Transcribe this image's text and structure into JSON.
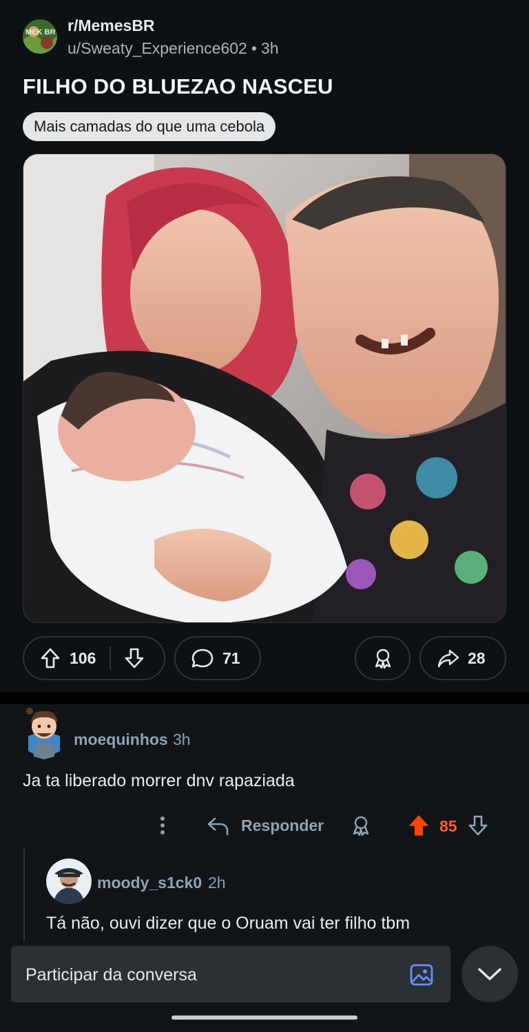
{
  "post": {
    "subreddit": "r/MemesBR",
    "author": "u/Sweaty_Experience602",
    "separator": "•",
    "time": "3h",
    "title": "FILHO DO BLUEZAO NASCEU",
    "flair": "Mais camadas do que uma cebola",
    "subreddit_avatar_text": "MEK BR",
    "upvotes": "106",
    "comments": "71",
    "shares": "28"
  },
  "comments": [
    {
      "user": "moequinhos",
      "time": "3h",
      "text": "Ja ta liberado morrer dnv rapaziada",
      "reply_label": "Responder",
      "score": "85",
      "score_color": "#ff5b21"
    },
    {
      "user": "moody_s1ck0",
      "time": "2h",
      "text": "Tá não, ouvi dizer que o Oruam vai ter filho tbm"
    }
  ],
  "composer": {
    "placeholder": "Participar da conversa"
  },
  "icons": {
    "upvote": "arrow-up-icon",
    "downvote": "arrow-down-icon",
    "comment": "speech-bubble-icon",
    "award": "award-icon",
    "share": "share-arrow-icon",
    "more": "vertical-dots-icon",
    "reply": "reply-arrow-icon",
    "image": "image-icon",
    "collapse": "chevron-down-icon"
  }
}
